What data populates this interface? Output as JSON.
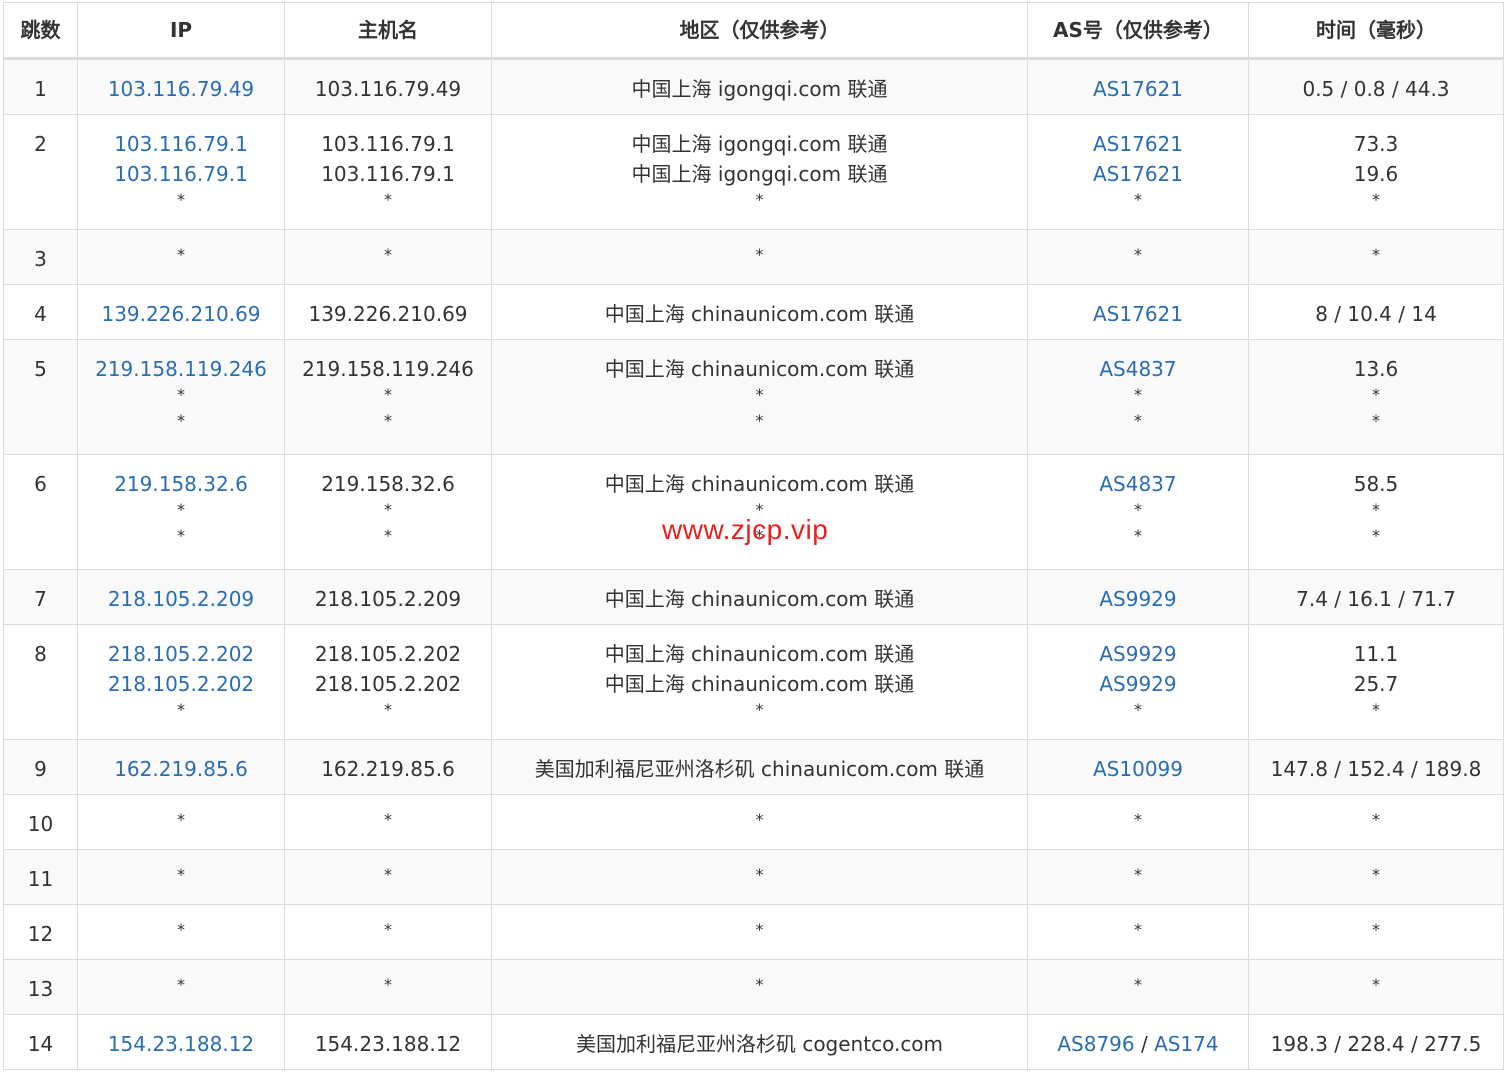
{
  "headers": [
    "跳数",
    "IP",
    "主机名",
    "地区（仅供参考）",
    "AS号（仅供参考）",
    "时间（毫秒）"
  ],
  "watermark": "www.zjcp.vip",
  "colors": {
    "link": "#2a6db0",
    "watermark": "#e8201f",
    "border": "#dcdcdc",
    "stripe": "#f9f9f9"
  },
  "rows": [
    {
      "hop": "1",
      "ip": [
        "103.116.79.49"
      ],
      "host": [
        "103.116.79.49"
      ],
      "region": [
        "中国上海 igongqi.com 联通"
      ],
      "as": [
        [
          "AS17621"
        ]
      ],
      "time": [
        "0.5 / 0.8 / 44.3"
      ]
    },
    {
      "hop": "2",
      "ip": [
        "103.116.79.1",
        "103.116.79.1",
        "*"
      ],
      "host": [
        "103.116.79.1",
        "103.116.79.1",
        "*"
      ],
      "region": [
        "中国上海 igongqi.com 联通",
        "中国上海 igongqi.com 联通",
        "*"
      ],
      "as": [
        [
          "AS17621"
        ],
        [
          "AS17621"
        ],
        [
          "*"
        ]
      ],
      "time": [
        "73.3",
        "19.6",
        "*"
      ]
    },
    {
      "hop": "3",
      "ip": [
        "*"
      ],
      "host": [
        "*"
      ],
      "region": [
        "*"
      ],
      "as": [
        [
          "*"
        ]
      ],
      "time": [
        "*"
      ]
    },
    {
      "hop": "4",
      "ip": [
        "139.226.210.69"
      ],
      "host": [
        "139.226.210.69"
      ],
      "region": [
        "中国上海 chinaunicom.com 联通"
      ],
      "as": [
        [
          "AS17621"
        ]
      ],
      "time": [
        "8 / 10.4 / 14"
      ]
    },
    {
      "hop": "5",
      "ip": [
        "219.158.119.246",
        "*",
        "*"
      ],
      "host": [
        "219.158.119.246",
        "*",
        "*"
      ],
      "region": [
        "中国上海 chinaunicom.com 联通",
        "*",
        "*"
      ],
      "as": [
        [
          "AS4837"
        ],
        [
          "*"
        ],
        [
          "*"
        ]
      ],
      "time": [
        "13.6",
        "*",
        "*"
      ]
    },
    {
      "hop": "6",
      "ip": [
        "219.158.32.6",
        "*",
        "*"
      ],
      "host": [
        "219.158.32.6",
        "*",
        "*"
      ],
      "region": [
        "中国上海 chinaunicom.com 联通",
        "*",
        "*"
      ],
      "as": [
        [
          "AS4837"
        ],
        [
          "*"
        ],
        [
          "*"
        ]
      ],
      "time": [
        "58.5",
        "*",
        "*"
      ]
    },
    {
      "hop": "7",
      "ip": [
        "218.105.2.209"
      ],
      "host": [
        "218.105.2.209"
      ],
      "region": [
        "中国上海 chinaunicom.com 联通"
      ],
      "as": [
        [
          "AS9929"
        ]
      ],
      "time": [
        "7.4 / 16.1 / 71.7"
      ]
    },
    {
      "hop": "8",
      "ip": [
        "218.105.2.202",
        "218.105.2.202",
        "*"
      ],
      "host": [
        "218.105.2.202",
        "218.105.2.202",
        "*"
      ],
      "region": [
        "中国上海 chinaunicom.com 联通",
        "中国上海 chinaunicom.com 联通",
        "*"
      ],
      "as": [
        [
          "AS9929"
        ],
        [
          "AS9929"
        ],
        [
          "*"
        ]
      ],
      "time": [
        "11.1",
        "25.7",
        "*"
      ]
    },
    {
      "hop": "9",
      "ip": [
        "162.219.85.6"
      ],
      "host": [
        "162.219.85.6"
      ],
      "region": [
        "美国加利福尼亚州洛杉矶 chinaunicom.com 联通"
      ],
      "as": [
        [
          "AS10099"
        ]
      ],
      "time": [
        "147.8 / 152.4 / 189.8"
      ]
    },
    {
      "hop": "10",
      "ip": [
        "*"
      ],
      "host": [
        "*"
      ],
      "region": [
        "*"
      ],
      "as": [
        [
          "*"
        ]
      ],
      "time": [
        "*"
      ]
    },
    {
      "hop": "11",
      "ip": [
        "*"
      ],
      "host": [
        "*"
      ],
      "region": [
        "*"
      ],
      "as": [
        [
          "*"
        ]
      ],
      "time": [
        "*"
      ]
    },
    {
      "hop": "12",
      "ip": [
        "*"
      ],
      "host": [
        "*"
      ],
      "region": [
        "*"
      ],
      "as": [
        [
          "*"
        ]
      ],
      "time": [
        "*"
      ]
    },
    {
      "hop": "13",
      "ip": [
        "*"
      ],
      "host": [
        "*"
      ],
      "region": [
        "*"
      ],
      "as": [
        [
          "*"
        ]
      ],
      "time": [
        "*"
      ]
    },
    {
      "hop": "14",
      "ip": [
        "154.23.188.12"
      ],
      "host": [
        "154.23.188.12"
      ],
      "region": [
        "美国加利福尼亚州洛杉矶 cogentco.com"
      ],
      "as": [
        [
          "AS8796",
          "AS174"
        ]
      ],
      "time": [
        "198.3 / 228.4 / 277.5"
      ]
    }
  ]
}
